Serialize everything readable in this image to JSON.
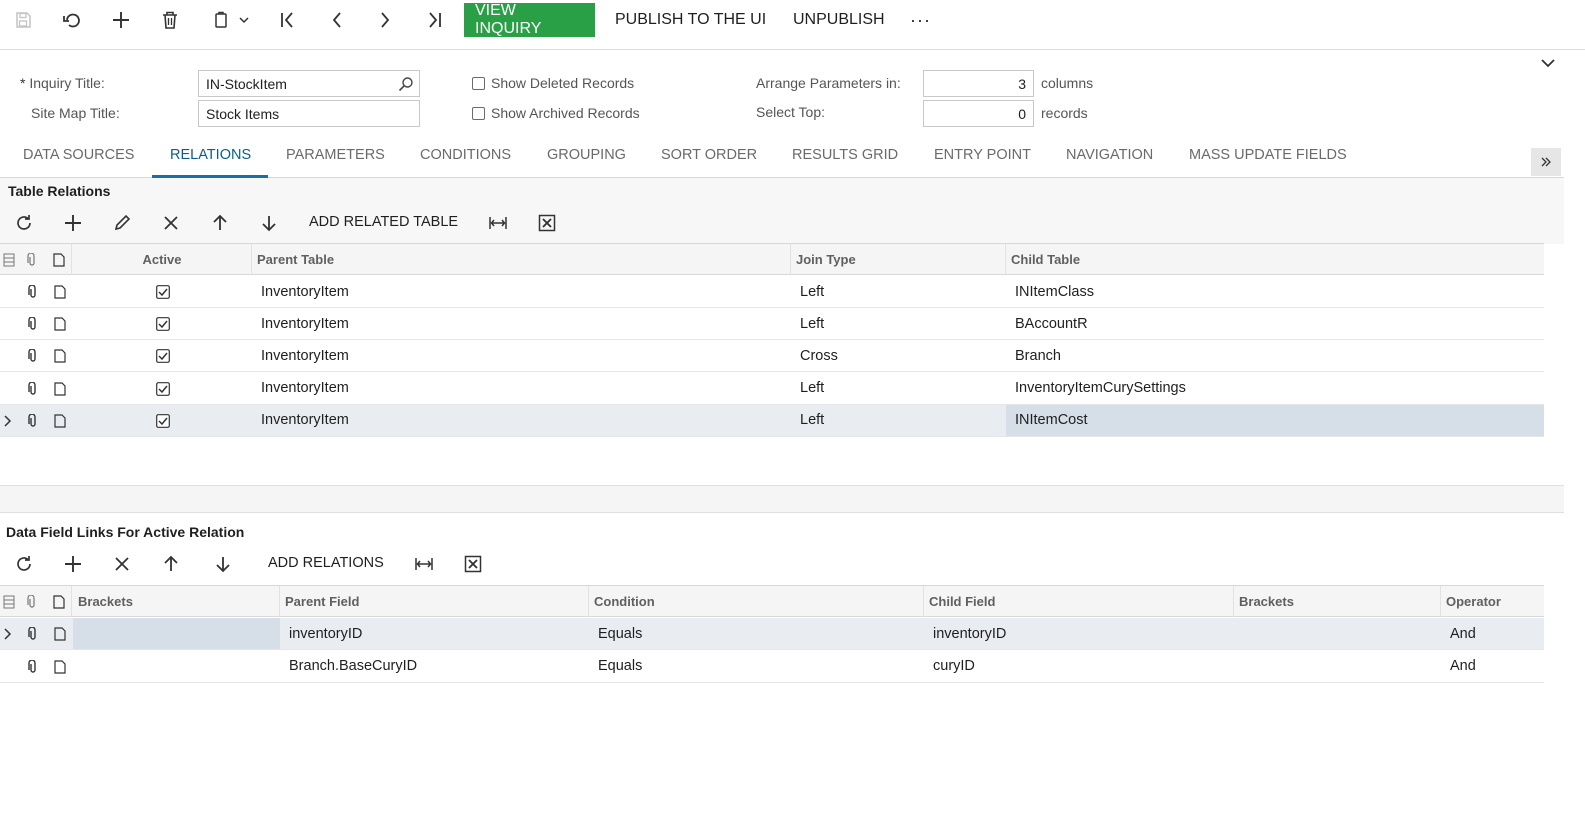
{
  "toolbar": {
    "view_inquiry": "VIEW INQUIRY",
    "publish": "PUBLISH TO THE UI",
    "unpublish": "UNPUBLISH",
    "more": "···"
  },
  "form": {
    "inquiry_title_label": "Inquiry Title:",
    "inquiry_title_required": "*",
    "inquiry_title_value": "IN-StockItem",
    "site_map_title_label": "Site Map Title:",
    "site_map_title_value": "Stock Items",
    "show_deleted_label": "Show Deleted Records",
    "show_archived_label": "Show Archived Records",
    "arrange_label": "Arrange Parameters in:",
    "arrange_value": "3",
    "arrange_unit": "columns",
    "select_top_label": "Select Top:",
    "select_top_value": "0",
    "select_top_unit": "records"
  },
  "tabs": [
    {
      "label": "DATA SOURCES"
    },
    {
      "label": "RELATIONS"
    },
    {
      "label": "PARAMETERS"
    },
    {
      "label": "CONDITIONS"
    },
    {
      "label": "GROUPING"
    },
    {
      "label": "SORT ORDER"
    },
    {
      "label": "RESULTS GRID"
    },
    {
      "label": "ENTRY POINT"
    },
    {
      "label": "NAVIGATION"
    },
    {
      "label": "MASS UPDATE FIELDS"
    }
  ],
  "active_tab": "RELATIONS",
  "relations": {
    "title": "Table Relations",
    "add_label": "ADD RELATED TABLE",
    "columns": [
      "Active",
      "Parent Table",
      "Join Type",
      "Child Table"
    ],
    "rows": [
      {
        "active": true,
        "parent": "InventoryItem",
        "join": "Left",
        "child": "INItemClass"
      },
      {
        "active": true,
        "parent": "InventoryItem",
        "join": "Left",
        "child": "BAccountR"
      },
      {
        "active": true,
        "parent": "InventoryItem",
        "join": "Cross",
        "child": "Branch"
      },
      {
        "active": true,
        "parent": "InventoryItem",
        "join": "Left",
        "child": "InventoryItemCurySettings"
      },
      {
        "active": true,
        "parent": "InventoryItem",
        "join": "Left",
        "child": "INItemCost"
      }
    ]
  },
  "links": {
    "title": "Data Field Links For Active Relation",
    "add_label": "ADD RELATIONS",
    "columns": [
      "Brackets",
      "Parent Field",
      "Condition",
      "Child Field",
      "Brackets",
      "Operator"
    ],
    "rows": [
      {
        "open": "",
        "parent": "inventoryID",
        "condition": "Equals",
        "child": "inventoryID",
        "close": "",
        "op": "And"
      },
      {
        "open": "",
        "parent": "Branch.BaseCuryID",
        "condition": "Equals",
        "child": "curyID",
        "close": "",
        "op": "And"
      }
    ]
  },
  "colors": {
    "accent_green": "#2aa046",
    "tab_active": "#0b5f8a",
    "selected_row": "#e9edf2"
  }
}
